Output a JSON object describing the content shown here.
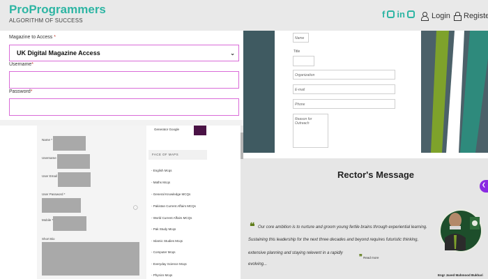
{
  "header": {
    "logo_title": "ProProgrammers",
    "logo_subtitle": "ALGORITHM OF SUCCESS",
    "social_icons": [
      "facebook-icon",
      "instagram-icon",
      "linkedin-icon",
      "email-icon"
    ],
    "login_label": "Login",
    "register_label": "Register",
    "accent_color": "#2db5a3"
  },
  "login_form": {
    "magazine_label": "Magazine to Access",
    "magazine_value": "UK Digital Magazine Access",
    "username_label": "Username",
    "username_value": "",
    "password_label": "Password",
    "password_value": "",
    "required_mark": "*"
  },
  "registration_form": {
    "name_label": "Name",
    "username_label": "Username",
    "user_email_label": "User Email",
    "user_password_label": "User Password",
    "mobile_label": "Mobile",
    "short_bio_label": "Short Bio",
    "required_mark": "*"
  },
  "sidebar": {
    "top_text": "Generator Google",
    "heading": "FACE OF MAPS",
    "items": [
      "English Mcqs",
      "Maths Mcqs",
      "General Knowledge MCQs",
      "Pakistan Current Affairs MCQs",
      "World Current Affairs MCQs",
      "Pak Study Mcqs",
      "Islamic Studies Mcqs",
      "Computer Mcqs",
      "Everyday Science Mcqs",
      "Physics Mcqs"
    ]
  },
  "contact_form": {
    "name_placeholder": "Name",
    "title_label": "Title",
    "organization_placeholder": "Organization",
    "email_placeholder": "E-mail",
    "phone_placeholder": "Phone",
    "reason_placeholder": "Reason for Outreach"
  },
  "rector": {
    "title": "Rector's Message",
    "quote_lines": [
      "Our core ambition is to nurture and groom young fertile brains through experiential learning.",
      "Sustaining this leadership for the next three decades and beyond requires futuristic thinking,",
      "extensive planning and staying relevent in a rapidly evolving..."
    ],
    "read_more": "Read more",
    "name": "Engr Javed Mahmood Bukhari",
    "accent_color": "#5f7d1a"
  }
}
